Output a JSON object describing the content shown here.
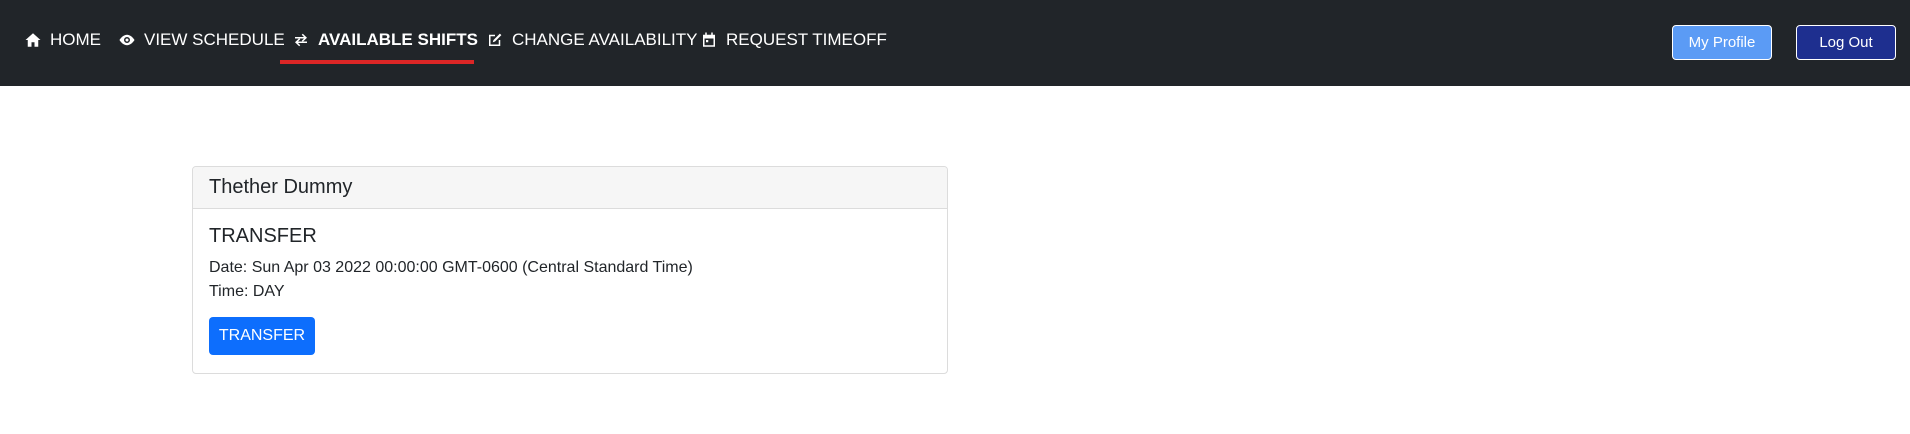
{
  "nav": {
    "items": [
      {
        "label": "HOME",
        "icon": "home-icon"
      },
      {
        "label": "VIEW SCHEDULE",
        "icon": "eye-icon"
      },
      {
        "label": "AVAILABLE SHIFTS",
        "icon": "swap-arrows-icon",
        "active": true
      },
      {
        "label": "CHANGE AVAILABILITY",
        "icon": "edit-icon"
      },
      {
        "label": "REQUEST TIMEOFF",
        "icon": "calendar-icon"
      }
    ],
    "active_color": "#dc2626",
    "background": "#212529"
  },
  "header_buttons": {
    "profile_label": "My Profile",
    "logout_label": "Log Out"
  },
  "shift_card": {
    "employee_name": "Thether Dummy",
    "type": "TRANSFER",
    "date_text": "Date: Sun Apr 03 2022 00:00:00 GMT-0600 (Central Standard Time)",
    "time_text": "Time: DAY",
    "action_label": "TRANSFER"
  }
}
